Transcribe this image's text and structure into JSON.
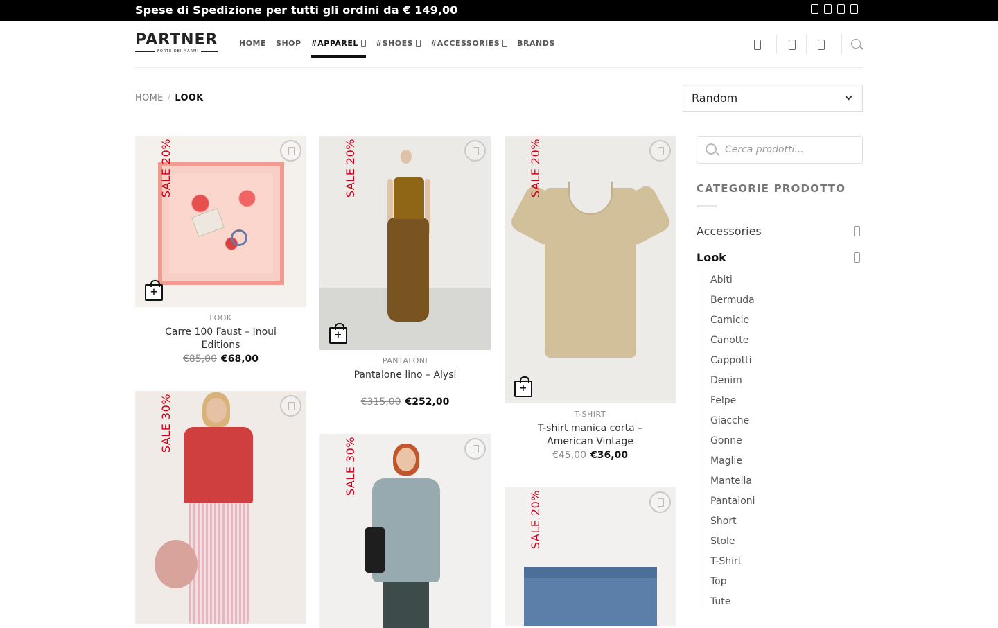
{
  "topbar": {
    "message": "Spese di Spedizione per tutti gli ordini da € 149,00",
    "social_icons": [
      "facebook-icon",
      "instagram-icon",
      "email-icon",
      "phone-icon"
    ]
  },
  "header": {
    "logo_text": "PARTNER",
    "logo_subtitle": "FORTE DEI MARMI",
    "nav": [
      "HOME",
      "SHOP",
      "#APPAREL",
      "#SHOES",
      "#ACCESSORIES",
      "BRANDS"
    ],
    "icons": [
      "user-icon",
      "wishlist-icon",
      "cart-icon",
      "search-icon"
    ]
  },
  "breadcrumb": {
    "home": "HOME",
    "separator": "/",
    "current": "LOOK"
  },
  "sort": {
    "selected": "Random"
  },
  "products": [
    {
      "sale": "SALE 20%",
      "category": "LOOK",
      "name": "Carre 100 Faust – Inoui Editions",
      "old_price": "€85,00",
      "price": "€68,00"
    },
    {
      "sale": "SALE 20%",
      "category": "PANTALONI",
      "name": "Pantalone lino – Alysi",
      "old_price": "€315,00",
      "price": "€252,00"
    },
    {
      "sale": "SALE 20%",
      "category": "T-SHIRT",
      "name": "T-shirt manica corta – American Vintage",
      "old_price": "€45,00",
      "price": "€36,00"
    },
    {
      "sale": "SALE 30%"
    },
    {
      "sale": "SALE 30%"
    },
    {
      "sale": "SALE 20%"
    }
  ],
  "add_to_cart_symbol": "+",
  "sidebar": {
    "search_placeholder": "Cerca prodotti...",
    "title": "CATEGORIE PRODOTTO",
    "categories": [
      "Accessories",
      "Look"
    ],
    "subcategories": [
      "Abiti",
      "Bermuda",
      "Camicie",
      "Canotte",
      "Cappotti",
      "Denim",
      "Felpe",
      "Giacche",
      "Gonne",
      "Maglie",
      "Mantella",
      "Pantaloni",
      "Short",
      "Stole",
      "T-Shirt",
      "Top",
      "Tute"
    ]
  }
}
